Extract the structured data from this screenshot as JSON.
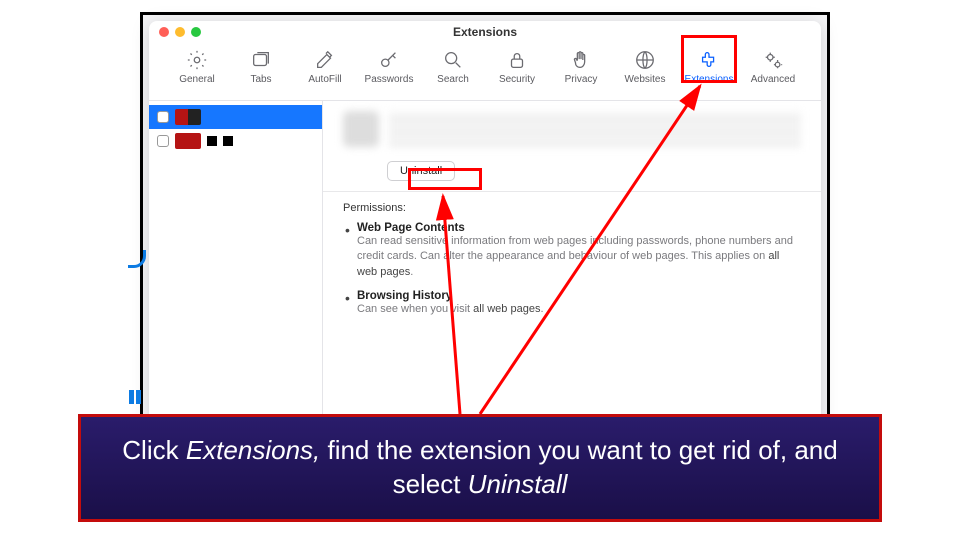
{
  "window": {
    "title": "Extensions"
  },
  "toolbar": {
    "items": [
      {
        "label": "General"
      },
      {
        "label": "Tabs"
      },
      {
        "label": "AutoFill"
      },
      {
        "label": "Passwords"
      },
      {
        "label": "Search"
      },
      {
        "label": "Security"
      },
      {
        "label": "Privacy"
      },
      {
        "label": "Websites"
      },
      {
        "label": "Extensions"
      },
      {
        "label": "Advanced"
      }
    ]
  },
  "detail": {
    "uninstall_label": "Uninstall",
    "permissions_label": "Permissions:",
    "perm1_h": "Web Page Contents",
    "perm1_d_pre": "Can read sensitive information from web pages including passwords, phone numbers and credit cards. Can alter the appearance and behaviour of web pages. This applies on ",
    "perm1_d_bold": "all web pages",
    "perm2_h": "Browsing History",
    "perm2_d_pre": "Can see when you visit ",
    "perm2_d_bold": "all web pages"
  },
  "caption": {
    "pre": "Click ",
    "em1": "Extensions,",
    "mid": " find the extension you want to get rid of, and select ",
    "em2": "Uninstall"
  },
  "colors": {
    "accent": "#0a60ff",
    "highlight": "#ff0000",
    "caption_bg": "#2a1c6b",
    "caption_border": "#c40c0c"
  }
}
